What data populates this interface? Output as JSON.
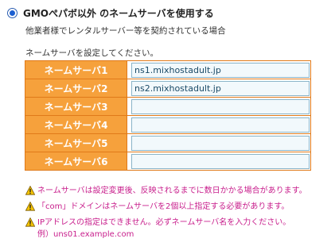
{
  "option": {
    "label": "GMOぺパボ以外 のネームサーバを使用する",
    "selected": true,
    "subtitle": "他業者様でレンタルサーバー等を契約されている場合"
  },
  "instruction": "ネームサーバを設定してください。",
  "nameservers": [
    {
      "label": "ネームサーバ1",
      "value": "ns1.mixhostadult.jp"
    },
    {
      "label": "ネームサーバ2",
      "value": "ns2.mixhostadult.jp"
    },
    {
      "label": "ネームサーバ3",
      "value": ""
    },
    {
      "label": "ネームサーバ4",
      "value": ""
    },
    {
      "label": "ネームサーバ5",
      "value": ""
    },
    {
      "label": "ネームサーバ6",
      "value": ""
    }
  ],
  "notes": [
    {
      "icon": "warning-icon",
      "text": "ネームサーバは設定変更後、反映されるまでに数日かかる場合があります。"
    },
    {
      "icon": "warning-icon",
      "text": "「com」ドメインはネームサーバを2個以上指定する必要があります。"
    },
    {
      "icon": "warning-icon",
      "text": "IPアドレスの指定はできません。必ずネームサーバ名を入力ください。",
      "example": "例）uns01.example.com"
    }
  ],
  "colors": {
    "label_bg": "#f6a13c",
    "table_border": "#e07a1a",
    "note_text": "#c81e8c",
    "radio": "#1c5fd1"
  }
}
